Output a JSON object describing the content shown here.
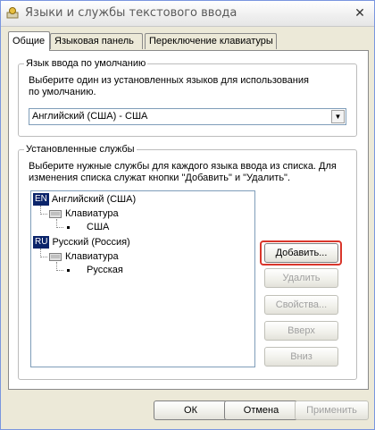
{
  "window": {
    "title": "Языки и службы текстового ввода",
    "close_symbol": "✕"
  },
  "tabs": [
    {
      "label": "Общие",
      "active": true
    },
    {
      "label": "Языковая панель",
      "active": false
    },
    {
      "label": "Переключение клавиатуры",
      "active": false
    }
  ],
  "default_language": {
    "group_title": "Язык ввода по умолчанию",
    "description_line1": "Выберите один из установленных языков для использования",
    "description_line2": "по умолчанию.",
    "selected_value": "Английский (США) - США"
  },
  "installed_services": {
    "group_title": "Установленные службы",
    "description_line1": "Выберите нужные службы для каждого языка ввода из списка. Для",
    "description_line2": "изменения списка служат кнопки \"Добавить\" и \"Удалить\".",
    "tree": [
      {
        "badge": "EN",
        "language": "Английский (США)",
        "keyboard_label": "Клавиатура",
        "layout": "США"
      },
      {
        "badge": "RU",
        "language": "Русский (Россия)",
        "keyboard_label": "Клавиатура",
        "layout": "Русская"
      }
    ],
    "buttons": {
      "add": "Добавить...",
      "remove": "Удалить",
      "properties": "Свойства...",
      "up": "Вверх",
      "down": "Вниз"
    }
  },
  "dialog_buttons": {
    "ok": "ОК",
    "cancel": "Отмена",
    "apply": "Применить"
  },
  "colors": {
    "highlight": "#d9362b",
    "selection_badge": "#0a246a"
  }
}
